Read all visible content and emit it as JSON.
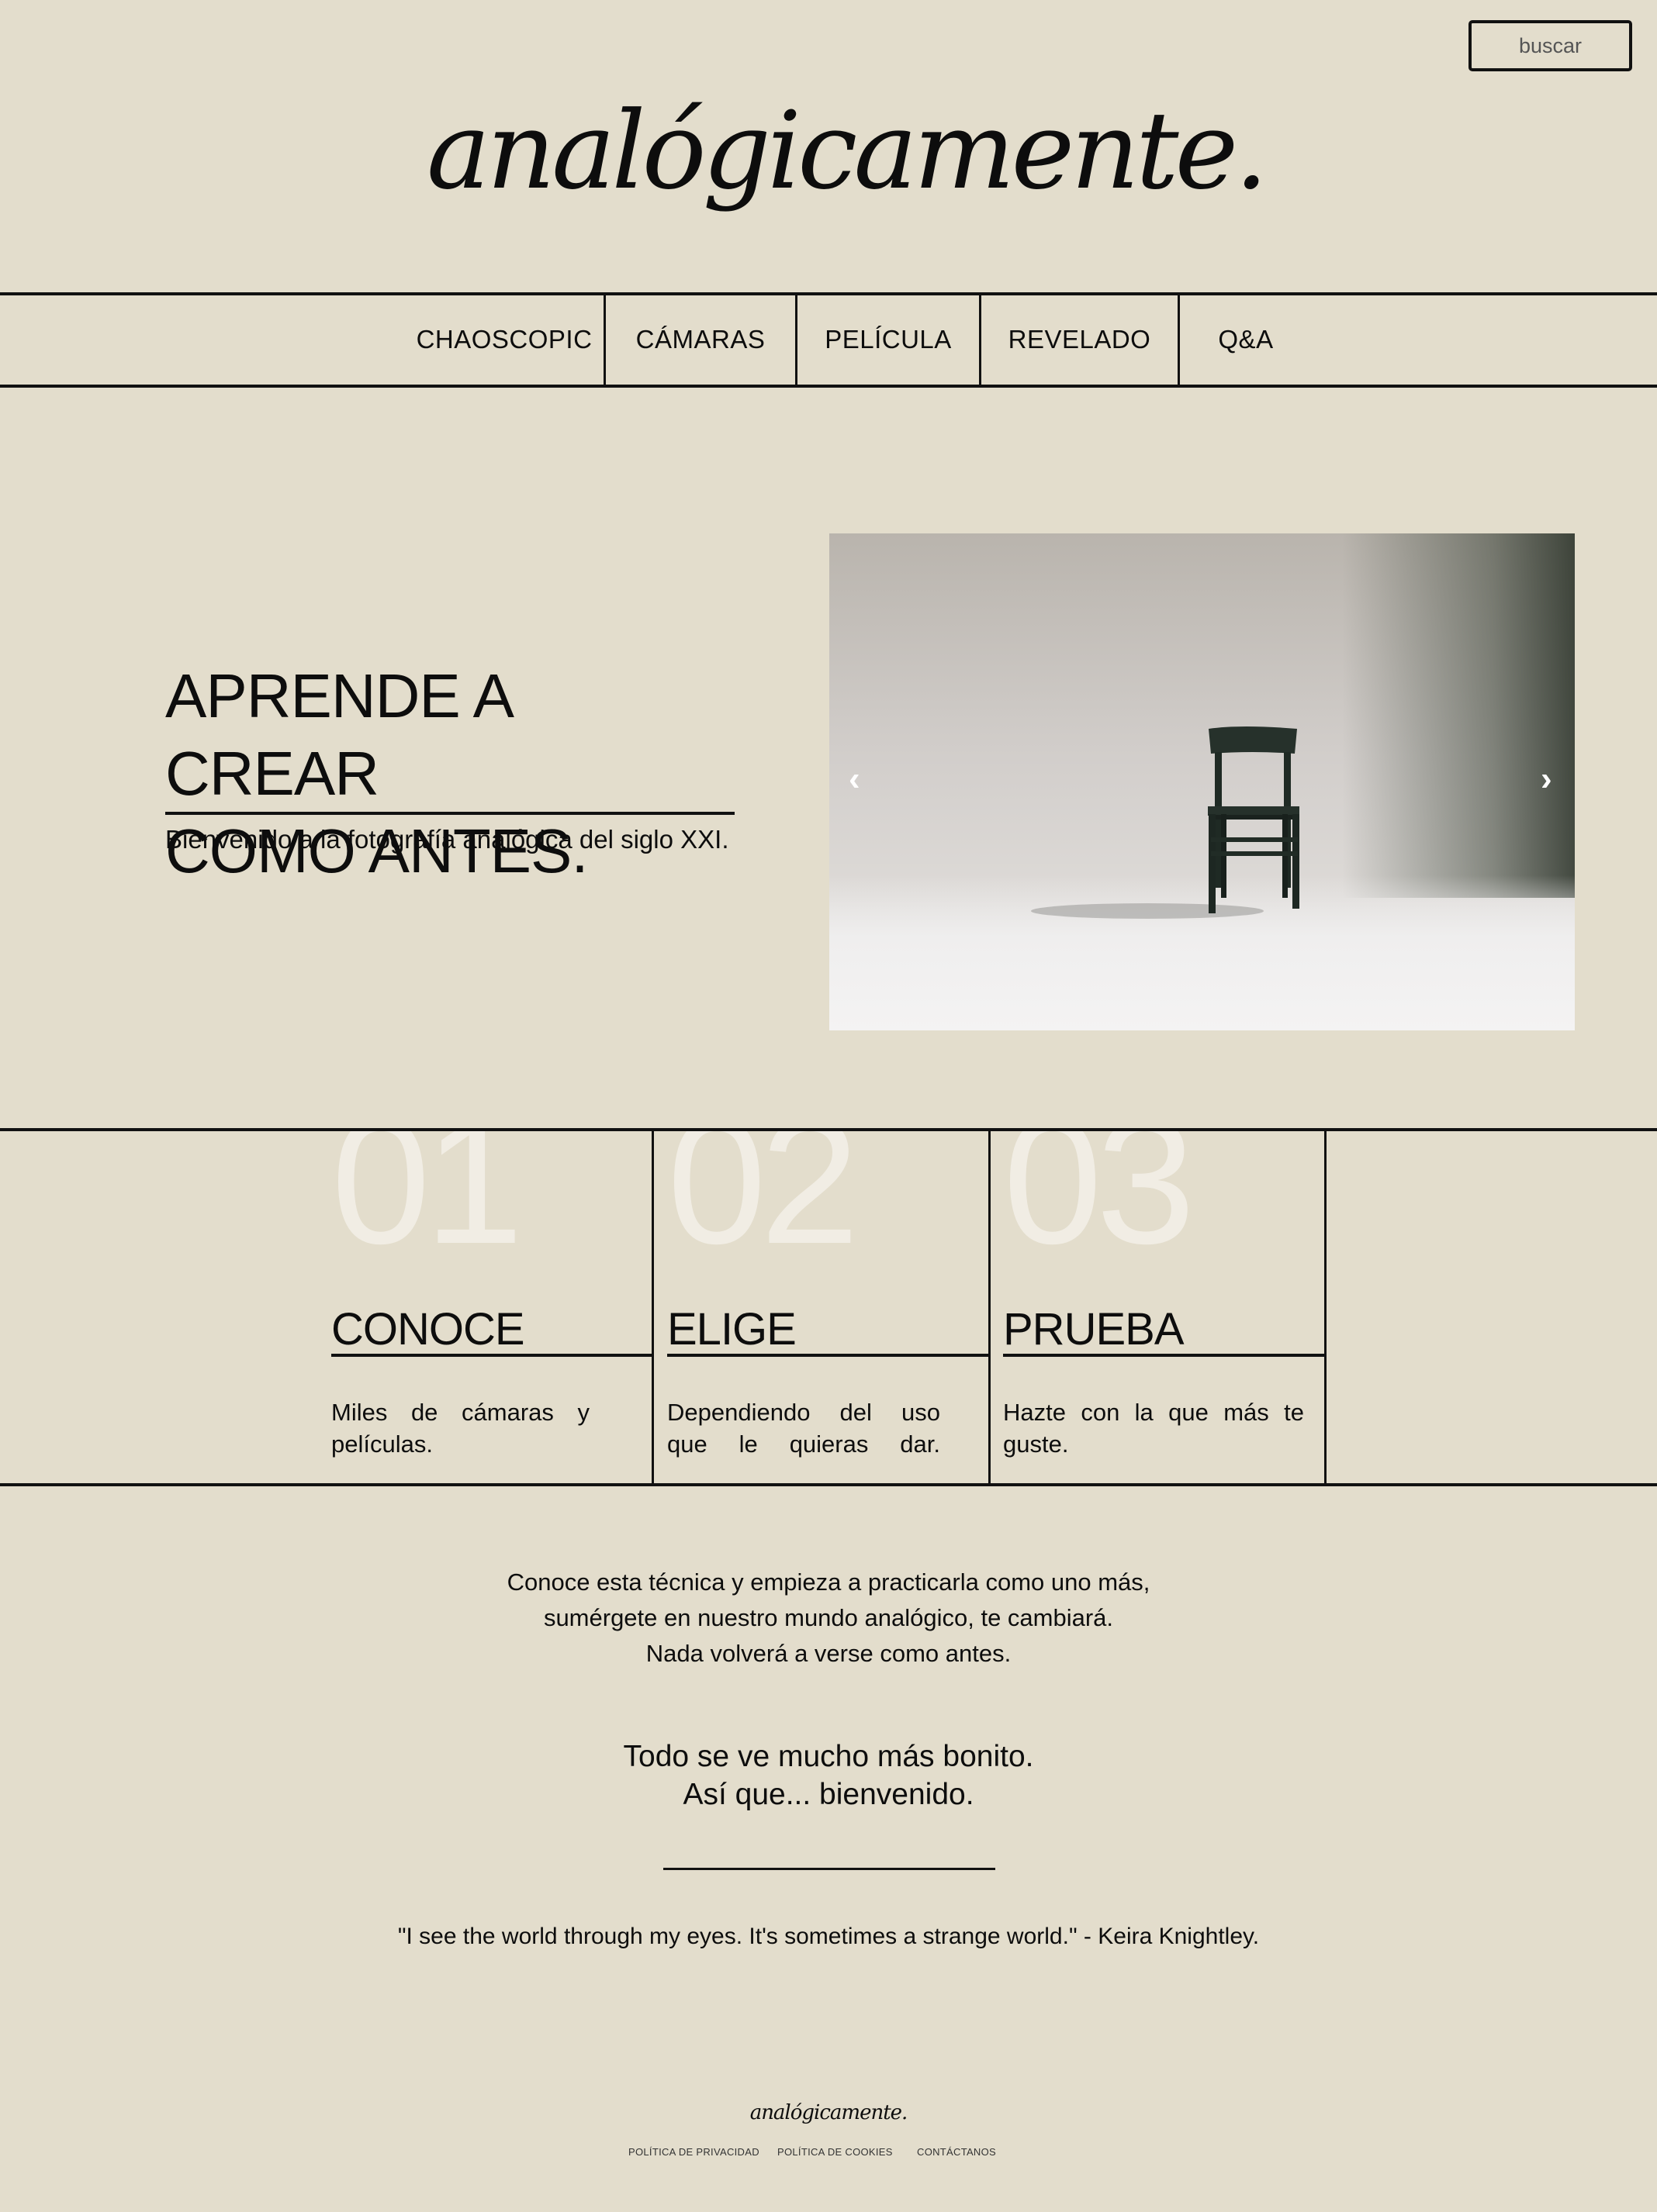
{
  "search": {
    "label": "buscar"
  },
  "logo": {
    "text": "analógicamente."
  },
  "nav": {
    "items": [
      {
        "label": "CHAOSCOPIC"
      },
      {
        "label": "CÁMARAS"
      },
      {
        "label": "PELÍCULA"
      },
      {
        "label": "REVELADO"
      },
      {
        "label": "Q&A"
      }
    ]
  },
  "hero": {
    "title_line1": "APRENDE A CREAR",
    "title_line2": "COMO ANTES.",
    "subtitle": "Bienvenido a la fotografía analógica del siglo XXI.",
    "carousel": {
      "prev": "‹",
      "next": "›",
      "image": "photo of a dark green wooden chair in an empty white studio"
    }
  },
  "steps": [
    {
      "number": "01",
      "title": "CONOCE",
      "desc": "Miles de cámaras y películas."
    },
    {
      "number": "02",
      "title": "ELIGE",
      "desc": "Dependiendo del uso que le quieras dar."
    },
    {
      "number": "03",
      "title": "PRUEBA",
      "desc": "Hazte con la que más te guste."
    }
  ],
  "intro": {
    "line1": "Conoce esta técnica y empieza a practicarla como uno más,",
    "line2": "sumérgete en nuestro mundo analógico, te cambiará.",
    "line3": "Nada volverá a verse como antes."
  },
  "tagline": {
    "line1": "Todo se ve mucho más bonito.",
    "line2": "Así que... bienvenido."
  },
  "quote": {
    "text": "\"I see the world through my eyes. It's sometimes a strange world.\" - Keira Knightley."
  },
  "footer": {
    "logo": "analógicamente.",
    "links": [
      {
        "label": "POLÍTICA DE PRIVACIDAD"
      },
      {
        "label": "POLÍTICA DE COOKIES"
      },
      {
        "label": "CONTÁCTANOS"
      }
    ]
  }
}
